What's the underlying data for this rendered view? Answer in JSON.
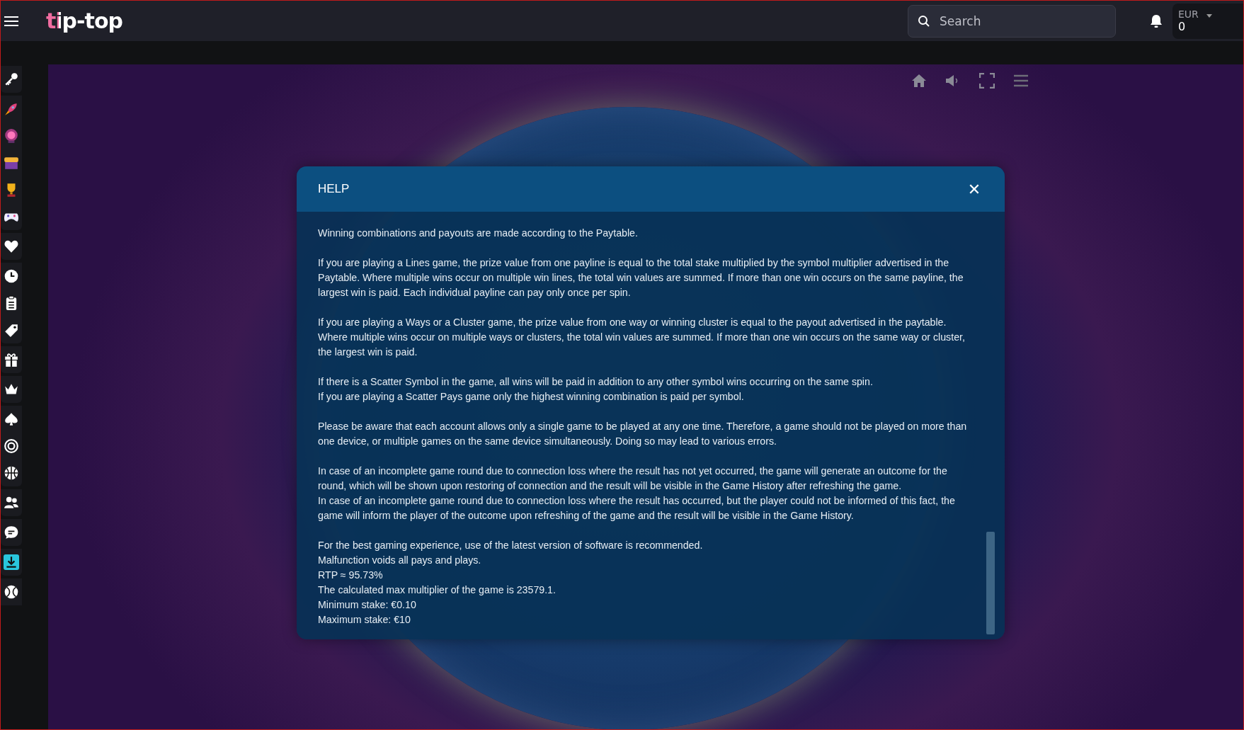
{
  "topbar": {
    "logo": "tip-top",
    "search": {
      "placeholder": "Search"
    },
    "balance": {
      "currency": "EUR",
      "amount": "0"
    }
  },
  "sidebar": {
    "items": [
      {
        "selected": false
      },
      {
        "selected": false
      },
      {
        "selected": false
      },
      {
        "selected": false
      },
      {
        "selected": false
      },
      {
        "selected": false
      },
      {
        "selected": false
      },
      {
        "selected": false
      },
      {
        "selected": false
      },
      {
        "selected": false
      },
      {
        "selected": false
      },
      {
        "selected": false
      },
      {
        "selected": false
      },
      {
        "selected": false
      },
      {
        "selected": false
      },
      {
        "selected": false
      },
      {
        "selected": false
      },
      {
        "selected": true
      },
      {
        "selected": false
      }
    ]
  },
  "dialog": {
    "title": "HELP",
    "close": "✕",
    "blocks": [
      [
        "Winning combinations and payouts are made according to the Paytable."
      ],
      [
        "If you are playing a Lines game, the prize value from one payline is equal to the total stake multiplied by the symbol multiplier advertised in the Paytable. Where multiple wins occur on multiple win lines, the total win values are summed. If more than one win occurs on the same payline, the largest win is paid. Each individual payline can pay only once per spin."
      ],
      [
        "If you are playing a Ways or a Cluster game, the prize value from one way or winning cluster is equal to the payout advertised in the paytable. Where multiple wins occur on multiple ways or clusters, the total win values are summed. If more than one win occurs on the same way or cluster, the largest win is paid."
      ],
      [
        "If there is a Scatter Symbol in the game, all wins will be paid in addition to any other symbol wins occurring on the same spin.",
        "If you are playing a Scatter Pays game only the highest winning combination is paid per symbol."
      ],
      [
        "Please be aware that each account allows only a single game to be played at any one time. Therefore, a game should not be played on more than one device, or multiple games on the same device simultaneously. Doing so may lead to various errors."
      ],
      [
        "In case of an incomplete game round due to connection loss where the result has not yet occurred, the game will generate an outcome for the round, which will be shown upon restoring of connection and the result will be visible in the Game History after refreshing the game.",
        "In case of an incomplete game round due to connection loss where the result has occurred, but the player could not be informed of this fact, the game will inform the player of the outcome upon refreshing of the game and the result will be visible in the Game History."
      ],
      [
        "For the best gaming experience, use of the latest version of software is recommended.",
        "Malfunction voids all pays and plays.",
        "RTP ≈ 95.73%",
        "The calculated max multiplier of the game is 23579.1.",
        "Minimum stake: €0.10",
        "Maximum stake: €10"
      ]
    ]
  }
}
